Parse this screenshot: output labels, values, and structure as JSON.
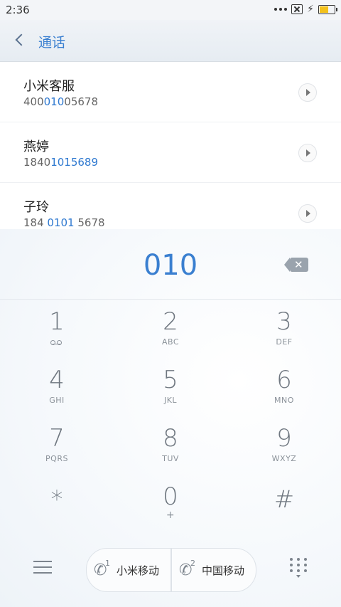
{
  "status": {
    "time": "2:36"
  },
  "header": {
    "title": "通话"
  },
  "contacts": [
    {
      "name": "小米客服",
      "num_pre": "400",
      "num_hl": "010",
      "num_post": "05678"
    },
    {
      "name": "燕婷",
      "num_pre": "1840",
      "num_hl": "1015689",
      "num_post": ""
    },
    {
      "name": "子玲",
      "num_pre": "184 ",
      "num_hl": "0101",
      "num_post": " 5678"
    }
  ],
  "dial": {
    "entered": "010"
  },
  "keys": [
    {
      "digit": "1",
      "letters": ""
    },
    {
      "digit": "2",
      "letters": "ABC"
    },
    {
      "digit": "3",
      "letters": "DEF"
    },
    {
      "digit": "4",
      "letters": "GHI"
    },
    {
      "digit": "5",
      "letters": "JKL"
    },
    {
      "digit": "6",
      "letters": "MNO"
    },
    {
      "digit": "7",
      "letters": "PQRS"
    },
    {
      "digit": "8",
      "letters": "TUV"
    },
    {
      "digit": "9",
      "letters": "WXYZ"
    },
    {
      "digit": "*",
      "letters": ""
    },
    {
      "digit": "0",
      "letters": "+"
    },
    {
      "digit": "#",
      "letters": ""
    }
  ],
  "call_buttons": [
    {
      "sim": "1",
      "label": "小米移动"
    },
    {
      "sim": "2",
      "label": "中国移动"
    }
  ],
  "icons": {
    "back": "chevron-left-icon",
    "delete": "backspace-icon",
    "menu": "hamburger-icon",
    "dialpad": "dialpad-icon",
    "phone": "phone-icon",
    "voicemail": "voicemail-icon"
  },
  "colors": {
    "accent": "#3a7fd0"
  }
}
